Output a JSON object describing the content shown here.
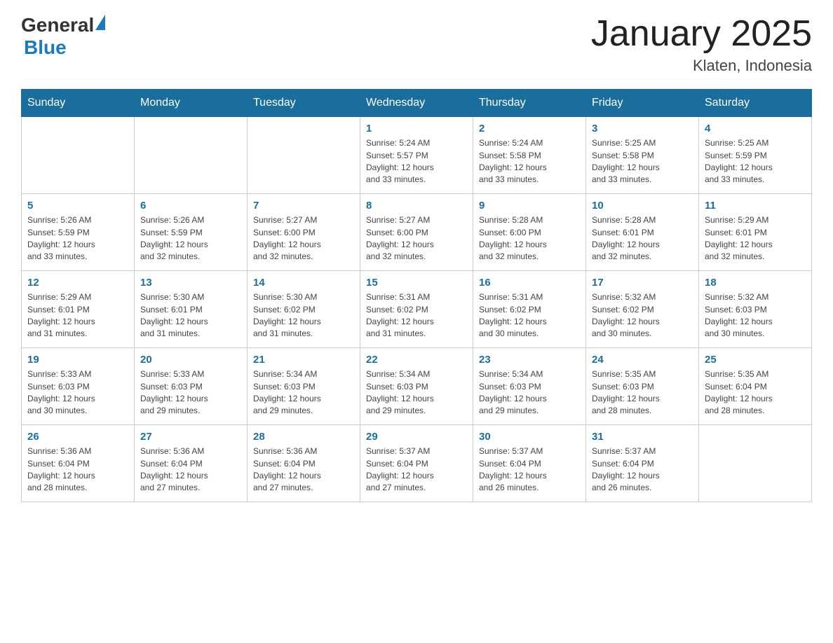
{
  "header": {
    "logo": {
      "general": "General",
      "blue": "Blue"
    },
    "title": "January 2025",
    "subtitle": "Klaten, Indonesia"
  },
  "weekdays": [
    "Sunday",
    "Monday",
    "Tuesday",
    "Wednesday",
    "Thursday",
    "Friday",
    "Saturday"
  ],
  "weeks": [
    [
      {
        "day": "",
        "info": ""
      },
      {
        "day": "",
        "info": ""
      },
      {
        "day": "",
        "info": ""
      },
      {
        "day": "1",
        "info": "Sunrise: 5:24 AM\nSunset: 5:57 PM\nDaylight: 12 hours\nand 33 minutes."
      },
      {
        "day": "2",
        "info": "Sunrise: 5:24 AM\nSunset: 5:58 PM\nDaylight: 12 hours\nand 33 minutes."
      },
      {
        "day": "3",
        "info": "Sunrise: 5:25 AM\nSunset: 5:58 PM\nDaylight: 12 hours\nand 33 minutes."
      },
      {
        "day": "4",
        "info": "Sunrise: 5:25 AM\nSunset: 5:59 PM\nDaylight: 12 hours\nand 33 minutes."
      }
    ],
    [
      {
        "day": "5",
        "info": "Sunrise: 5:26 AM\nSunset: 5:59 PM\nDaylight: 12 hours\nand 33 minutes."
      },
      {
        "day": "6",
        "info": "Sunrise: 5:26 AM\nSunset: 5:59 PM\nDaylight: 12 hours\nand 32 minutes."
      },
      {
        "day": "7",
        "info": "Sunrise: 5:27 AM\nSunset: 6:00 PM\nDaylight: 12 hours\nand 32 minutes."
      },
      {
        "day": "8",
        "info": "Sunrise: 5:27 AM\nSunset: 6:00 PM\nDaylight: 12 hours\nand 32 minutes."
      },
      {
        "day": "9",
        "info": "Sunrise: 5:28 AM\nSunset: 6:00 PM\nDaylight: 12 hours\nand 32 minutes."
      },
      {
        "day": "10",
        "info": "Sunrise: 5:28 AM\nSunset: 6:01 PM\nDaylight: 12 hours\nand 32 minutes."
      },
      {
        "day": "11",
        "info": "Sunrise: 5:29 AM\nSunset: 6:01 PM\nDaylight: 12 hours\nand 32 minutes."
      }
    ],
    [
      {
        "day": "12",
        "info": "Sunrise: 5:29 AM\nSunset: 6:01 PM\nDaylight: 12 hours\nand 31 minutes."
      },
      {
        "day": "13",
        "info": "Sunrise: 5:30 AM\nSunset: 6:01 PM\nDaylight: 12 hours\nand 31 minutes."
      },
      {
        "day": "14",
        "info": "Sunrise: 5:30 AM\nSunset: 6:02 PM\nDaylight: 12 hours\nand 31 minutes."
      },
      {
        "day": "15",
        "info": "Sunrise: 5:31 AM\nSunset: 6:02 PM\nDaylight: 12 hours\nand 31 minutes."
      },
      {
        "day": "16",
        "info": "Sunrise: 5:31 AM\nSunset: 6:02 PM\nDaylight: 12 hours\nand 30 minutes."
      },
      {
        "day": "17",
        "info": "Sunrise: 5:32 AM\nSunset: 6:02 PM\nDaylight: 12 hours\nand 30 minutes."
      },
      {
        "day": "18",
        "info": "Sunrise: 5:32 AM\nSunset: 6:03 PM\nDaylight: 12 hours\nand 30 minutes."
      }
    ],
    [
      {
        "day": "19",
        "info": "Sunrise: 5:33 AM\nSunset: 6:03 PM\nDaylight: 12 hours\nand 30 minutes."
      },
      {
        "day": "20",
        "info": "Sunrise: 5:33 AM\nSunset: 6:03 PM\nDaylight: 12 hours\nand 29 minutes."
      },
      {
        "day": "21",
        "info": "Sunrise: 5:34 AM\nSunset: 6:03 PM\nDaylight: 12 hours\nand 29 minutes."
      },
      {
        "day": "22",
        "info": "Sunrise: 5:34 AM\nSunset: 6:03 PM\nDaylight: 12 hours\nand 29 minutes."
      },
      {
        "day": "23",
        "info": "Sunrise: 5:34 AM\nSunset: 6:03 PM\nDaylight: 12 hours\nand 29 minutes."
      },
      {
        "day": "24",
        "info": "Sunrise: 5:35 AM\nSunset: 6:03 PM\nDaylight: 12 hours\nand 28 minutes."
      },
      {
        "day": "25",
        "info": "Sunrise: 5:35 AM\nSunset: 6:04 PM\nDaylight: 12 hours\nand 28 minutes."
      }
    ],
    [
      {
        "day": "26",
        "info": "Sunrise: 5:36 AM\nSunset: 6:04 PM\nDaylight: 12 hours\nand 28 minutes."
      },
      {
        "day": "27",
        "info": "Sunrise: 5:36 AM\nSunset: 6:04 PM\nDaylight: 12 hours\nand 27 minutes."
      },
      {
        "day": "28",
        "info": "Sunrise: 5:36 AM\nSunset: 6:04 PM\nDaylight: 12 hours\nand 27 minutes."
      },
      {
        "day": "29",
        "info": "Sunrise: 5:37 AM\nSunset: 6:04 PM\nDaylight: 12 hours\nand 27 minutes."
      },
      {
        "day": "30",
        "info": "Sunrise: 5:37 AM\nSunset: 6:04 PM\nDaylight: 12 hours\nand 26 minutes."
      },
      {
        "day": "31",
        "info": "Sunrise: 5:37 AM\nSunset: 6:04 PM\nDaylight: 12 hours\nand 26 minutes."
      },
      {
        "day": "",
        "info": ""
      }
    ]
  ]
}
